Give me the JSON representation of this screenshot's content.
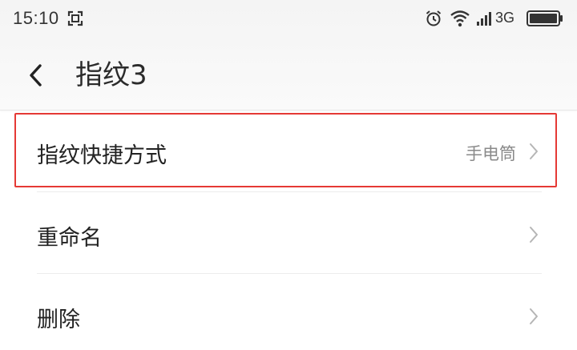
{
  "status_bar": {
    "time": "15:10",
    "network_type": "3G",
    "icons": [
      "screenshot-icon",
      "alarm-icon",
      "wifi-icon",
      "signal-icon",
      "battery-icon"
    ]
  },
  "header": {
    "title": "指纹3",
    "back_icon": "chevron-left-icon"
  },
  "settings": {
    "items": [
      {
        "label": "指纹快捷方式",
        "value": "手电筒",
        "highlighted": true
      },
      {
        "label": "重命名"
      },
      {
        "label": "删除"
      }
    ]
  },
  "colors": {
    "highlight_border": "#e53935",
    "title_bar_bg": "#f6f6f6",
    "secondary_text": "#8a8a8a",
    "chevron": "#b5b5b5"
  }
}
